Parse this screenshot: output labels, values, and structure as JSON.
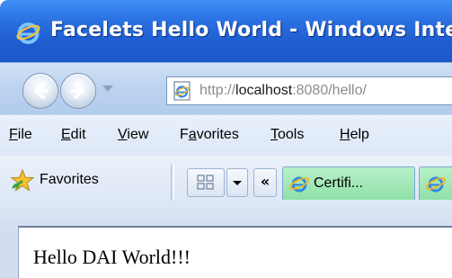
{
  "window": {
    "title": "Facelets Hello World - Windows Inte",
    "icon": "ie-logo-icon"
  },
  "navigation": {
    "back_icon": "back-arrow-icon",
    "forward_icon": "forward-arrow-icon",
    "recent_pages_icon": "chevron-down-icon",
    "address": {
      "scheme": "http://",
      "host": "localhost",
      "port": ":8080",
      "path": "/hello/"
    }
  },
  "menubar": {
    "items": [
      {
        "underline": "F",
        "rest": "ile"
      },
      {
        "underline": "E",
        "rest": "dit"
      },
      {
        "underline": "V",
        "rest": "iew"
      },
      {
        "pre": "F",
        "underline": "a",
        "rest": "vorites"
      },
      {
        "underline": "T",
        "rest": "ools"
      },
      {
        "underline": "H",
        "rest": "elp"
      }
    ]
  },
  "favorites_bar": {
    "label": "Favorites",
    "tab_scroll_label": "«",
    "tabs": [
      {
        "label": "Certifi..."
      },
      {
        "label": ""
      }
    ]
  },
  "content": {
    "text": "Hello DAI World!!!"
  },
  "colors": {
    "titlebar": "#2a6fe1",
    "tab_active": "#a0e6b6",
    "chrome": "#dde8f7"
  }
}
